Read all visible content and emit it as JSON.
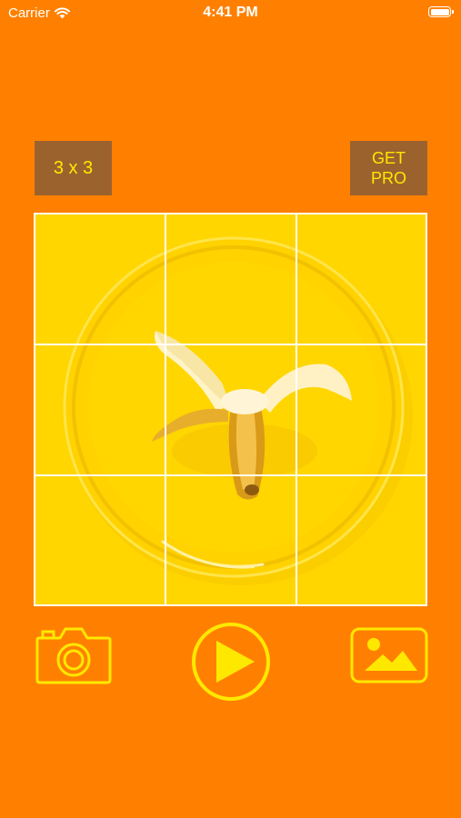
{
  "status_bar": {
    "carrier": "Carrier",
    "time": "4:41 PM",
    "icons": [
      "wifi-icon",
      "battery-icon"
    ]
  },
  "toolbar": {
    "grid_label": "3 x 3",
    "pro_label": "GET\nPRO"
  },
  "photo": {
    "subject": "banana-on-yellow-plate-image",
    "grid": {
      "rows": 3,
      "cols": 3
    }
  },
  "actions": {
    "icons": [
      "camera-icon",
      "play-icon",
      "gallery-icon"
    ]
  },
  "colors": {
    "background": "#FF8000",
    "accent": "#FFE800",
    "button_bg": "#9C622E",
    "photo_bg": "#FFD600",
    "grid_lines": "#FFFFFF"
  }
}
